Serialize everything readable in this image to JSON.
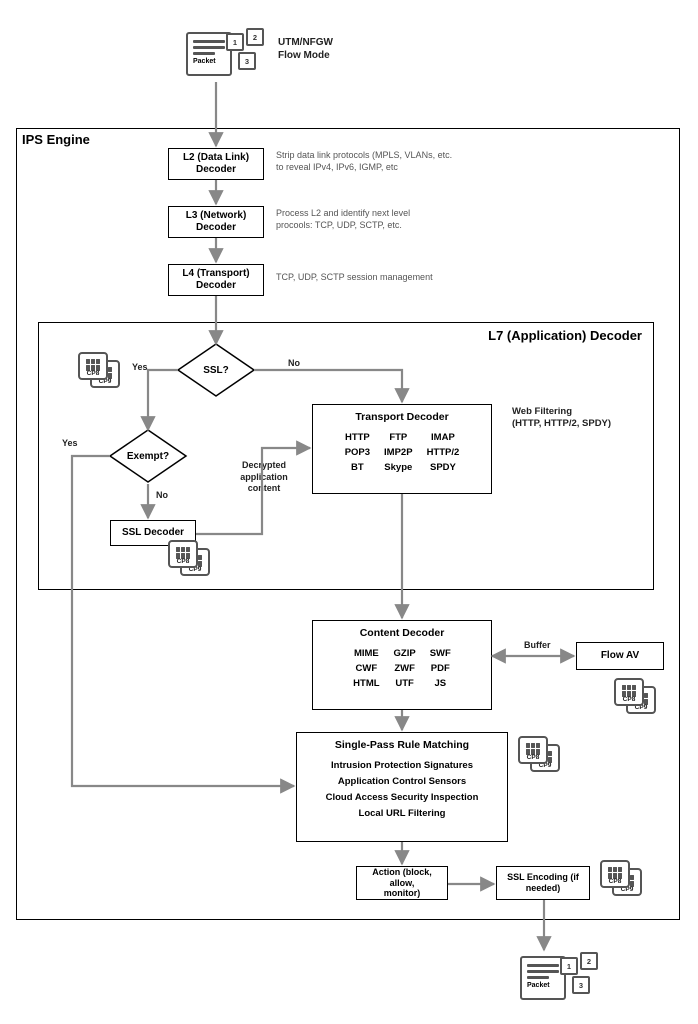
{
  "header": {
    "packet_label": "Packet",
    "mode_line1": "UTM/NFGW",
    "mode_line2": "Flow Mode"
  },
  "frames": {
    "ips_engine": "IPS Engine",
    "l7_decoder": "L7 (Application) Decoder"
  },
  "decoders": {
    "l2": {
      "line1": "L2 (Data Link)",
      "line2": "Decoder",
      "desc": "Strip data link protocols (MPLS, VLANs, etc.\nto reveal IPv4, IPv6, IGMP, etc"
    },
    "l3": {
      "line1": "L3 (Network)",
      "line2": "Decoder",
      "desc": "Process L2 and identify next level\nprocools: TCP, UDP, SCTP, etc."
    },
    "l4": {
      "line1": "L4 (Transport)",
      "line2": "Decoder",
      "desc": "TCP, UDP, SCTP session management"
    }
  },
  "l7": {
    "ssl_q": "SSL?",
    "exempt_q": "Exempt?",
    "ssl_decoder": "SSL Decoder",
    "decrypted_note": "Decrypted\napplication\ncontent",
    "transport": {
      "title": "Transport Decoder",
      "cells": [
        "HTTP",
        "FTP",
        "IMAP",
        "POP3",
        "IMP2P",
        "HTTP/2",
        "BT",
        "Skype",
        "SPDY"
      ]
    },
    "webfilter_note": "Web Filtering\n(HTTP, HTTP/2, SPDY)",
    "yes": "Yes",
    "no": "No"
  },
  "content": {
    "title": "Content Decoder",
    "cells": [
      "MIME",
      "GZIP",
      "SWF",
      "CWF",
      "ZWF",
      "PDF",
      "HTML",
      "UTF",
      "JS"
    ]
  },
  "buffer_label": "Buffer",
  "flow_av": "Flow AV",
  "rules": {
    "title": "Single-Pass Rule Matching",
    "items": [
      "Intrusion Protection Signatures",
      "Application Control Sensors",
      "Cloud Access Security Inspection",
      "Local URL Filtering"
    ]
  },
  "action": "Action (block, allow,\nmonitor)",
  "ssl_encode": "SSL Encoding (if\nneeded)",
  "footer_packet": "Packet",
  "cp": {
    "a": "CP8",
    "b": "CP9"
  }
}
